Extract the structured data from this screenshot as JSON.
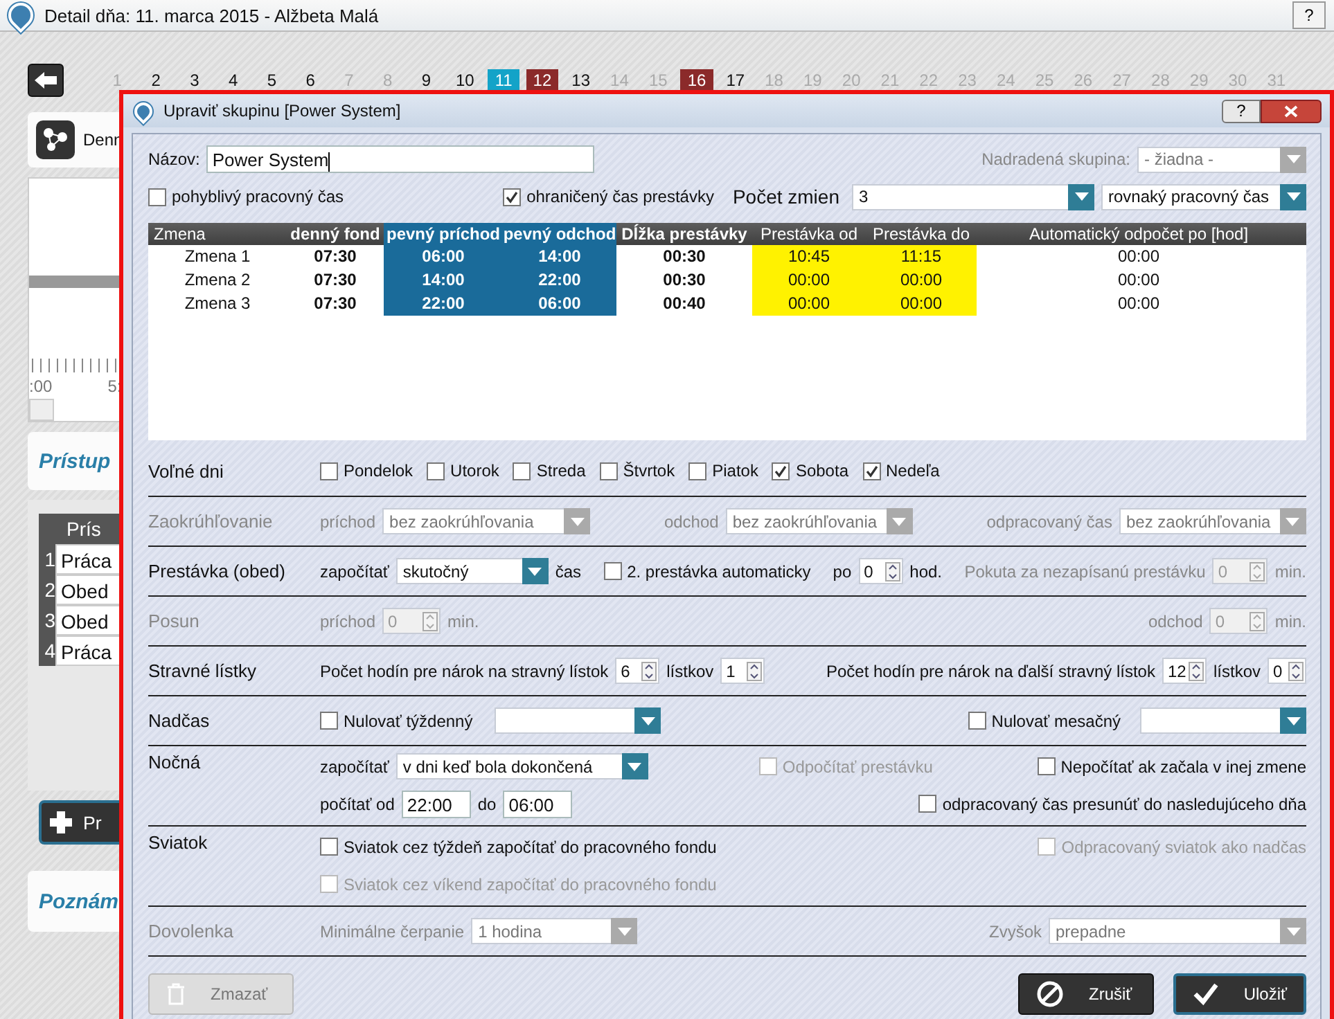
{
  "window": {
    "title": "Detail dňa: 11. marca 2015 -  Alžbeta Malá",
    "help": "?"
  },
  "days": [
    {
      "label": "1",
      "kind": "dim"
    },
    {
      "label": "2",
      "kind": "normal"
    },
    {
      "label": "3",
      "kind": "normal"
    },
    {
      "label": "4",
      "kind": "normal"
    },
    {
      "label": "5",
      "kind": "normal"
    },
    {
      "label": "6",
      "kind": "normal"
    },
    {
      "label": "7",
      "kind": "dim"
    },
    {
      "label": "8",
      "kind": "dim"
    },
    {
      "label": "9",
      "kind": "normal"
    },
    {
      "label": "10",
      "kind": "normal"
    },
    {
      "label": "11",
      "kind": "today"
    },
    {
      "label": "12",
      "kind": "holiday"
    },
    {
      "label": "13",
      "kind": "normal"
    },
    {
      "label": "14",
      "kind": "dim"
    },
    {
      "label": "15",
      "kind": "dim"
    },
    {
      "label": "16",
      "kind": "holiday"
    },
    {
      "label": "17",
      "kind": "normal"
    },
    {
      "label": "18",
      "kind": "dim"
    },
    {
      "label": "19",
      "kind": "dim"
    },
    {
      "label": "20",
      "kind": "dim"
    },
    {
      "label": "21",
      "kind": "dim"
    },
    {
      "label": "22",
      "kind": "dim"
    },
    {
      "label": "23",
      "kind": "dim"
    },
    {
      "label": "24",
      "kind": "dim"
    },
    {
      "label": "25",
      "kind": "dim"
    },
    {
      "label": "26",
      "kind": "dim"
    },
    {
      "label": "27",
      "kind": "dim"
    },
    {
      "label": "28",
      "kind": "dim"
    },
    {
      "label": "29",
      "kind": "dim"
    },
    {
      "label": "30",
      "kind": "dim"
    },
    {
      "label": "31",
      "kind": "dim"
    }
  ],
  "background": {
    "day_panel": "Denn",
    "timeline_ticks": [
      ":00",
      "5:"
    ],
    "access_title": "Prístup",
    "access_header": "Prís",
    "access_rows": [
      {
        "index": "1",
        "text": "Práca"
      },
      {
        "index": "2",
        "text": "Obed"
      },
      {
        "index": "3",
        "text": "Obed"
      },
      {
        "index": "4",
        "text": "Práca"
      }
    ],
    "add_button": "Pr",
    "notes_title": "Poznám"
  },
  "dialog": {
    "title": "Upraviť skupinu [Power System]",
    "help": "?",
    "name_label": "Názov:",
    "name": "Power System",
    "parent_label": "Nadradená skupina:",
    "parent": "- žiadna -",
    "flexible": {
      "label": "pohyblivý pracovný čas",
      "checked": false
    },
    "limited_break": {
      "label": "ohraničený čas prestávky",
      "checked": true
    },
    "shift_count_label": "Počet zmien",
    "shift_count": "3",
    "shift_mode": "rovnaký pracovný čas",
    "table": {
      "columns": [
        {
          "label": "Zmena",
          "kind": "name"
        },
        {
          "label": "denný fond",
          "kind": "bold"
        },
        {
          "label": "pevný príchod",
          "kind": "fixed"
        },
        {
          "label": "pevný odchod",
          "kind": "fixed"
        },
        {
          "label": "Dĺžka prestávky",
          "kind": "bold"
        },
        {
          "label": "Prestávka od",
          "kind": "break"
        },
        {
          "label": "Prestávka do",
          "kind": "break"
        },
        {
          "label": "Automatický odpočet po [hod]",
          "kind": "plain"
        }
      ],
      "rows": [
        [
          "Zmena 1",
          "07:30",
          "06:00",
          "14:00",
          "00:30",
          "10:45",
          "11:15",
          "00:00"
        ],
        [
          "Zmena 2",
          "07:30",
          "14:00",
          "22:00",
          "00:30",
          "00:00",
          "00:00",
          "00:00"
        ],
        [
          "Zmena 3",
          "07:30",
          "22:00",
          "06:00",
          "00:40",
          "00:00",
          "00:00",
          "00:00"
        ]
      ]
    },
    "free_days": {
      "label": "Voľné dni",
      "days": [
        {
          "label": "Pondelok",
          "checked": false
        },
        {
          "label": "Utorok",
          "checked": false
        },
        {
          "label": "Streda",
          "checked": false
        },
        {
          "label": "Štvrtok",
          "checked": false
        },
        {
          "label": "Piatok",
          "checked": false
        },
        {
          "label": "Sobota",
          "checked": true
        },
        {
          "label": "Nedeľa",
          "checked": true
        }
      ]
    },
    "rounding": {
      "label": "Zaokrúhľovanie",
      "disabled": true,
      "fields": [
        {
          "label": "príchod",
          "value": "bez zaokrúhľovania"
        },
        {
          "label": "odchod",
          "value": "bez zaokrúhľovania"
        },
        {
          "label": "odpracovaný čas",
          "value": "bez zaokrúhľovania"
        }
      ]
    },
    "lunch": {
      "label": "Prestávka (obed)",
      "count_label": "započítať",
      "mode": "skutočný",
      "suffix": "čas",
      "auto": {
        "label": "2. prestávka automaticky",
        "checked": false
      },
      "after_label": "po",
      "after": "0",
      "hours_label": "hod.",
      "penalty_label": "Pokuta za nezapísanú prestávku",
      "penalty": "0",
      "penalty_unit": "min.",
      "penalty_disabled": true
    },
    "offset": {
      "label": "Posun",
      "disabled": true,
      "arrival_label": "príchod",
      "arrival": "0",
      "arrival_unit": "min.",
      "departure_label": "odchod",
      "departure": "0",
      "departure_unit": "min."
    },
    "meal": {
      "label": "Stravné lístky",
      "hours_label": "Počet hodín pre nárok na stravný lístok",
      "hours": "6",
      "tickets_label": "lístkov",
      "tickets": "1",
      "next_hours_label": "Počet hodín pre nárok na ďalší stravný lístok",
      "next_hours": "12",
      "next_tickets_label": "lístkov",
      "next_tickets": "0"
    },
    "overtime": {
      "label": "Nadčas",
      "weekly": {
        "label": "Nulovať týždenný",
        "checked": false
      },
      "monthly": {
        "label": "Nulovať mesačný",
        "checked": false
      }
    },
    "night": {
      "label": "Nočná",
      "count_label": "započítať",
      "mode": "v dni keď bola dokončená",
      "deduct": {
        "label": "Odpočítať prestávku",
        "checked": false,
        "disabled": true
      },
      "skip": {
        "label": "Nepočítať ak začala v inej zmene",
        "checked": false
      },
      "from_label": "počítať od",
      "from": "22:00",
      "to_label": "do",
      "to": "06:00",
      "move": {
        "label": "odpracovaný čas presunúť do nasledujúceho dňa",
        "checked": false
      }
    },
    "holiday": {
      "label": "Sviatok",
      "weekday": {
        "label": "Sviatok cez týždeň započítať do pracovného fondu",
        "checked": false
      },
      "as_overtime": {
        "label": "Odpracovaný sviatok ako nadčas",
        "checked": false,
        "disabled": true
      },
      "weekend": {
        "label": "Sviatok cez víkend započítať do pracovného fondu",
        "checked": false,
        "disabled": true
      }
    },
    "leave": {
      "label": "Dovolenka",
      "disabled": true,
      "min_label": "Minimálne čerpanie",
      "min": "1 hodina",
      "rest_label": "Zvyšok",
      "rest": "prepadne"
    },
    "buttons": [
      {
        "label": "Zmazať",
        "kind": "delete",
        "disabled": true
      },
      {
        "label": "Zrušiť",
        "kind": "cancel",
        "disabled": false
      },
      {
        "label": "Uložiť",
        "kind": "save",
        "disabled": false
      }
    ]
  }
}
